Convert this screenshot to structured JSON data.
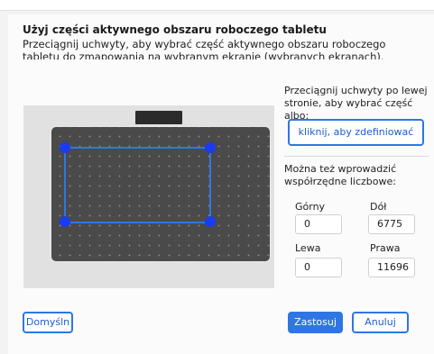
{
  "dialog": {
    "title": "Użyj części aktywnego obszaru roboczego tabletu",
    "description": "Przeciągnij uchwyty, aby wybrać część aktywnego obszaru roboczego tabletu do zmapowania na wybranym ekranie (wybranych ekranach)."
  },
  "side_panel": {
    "drag_instructions": "Przeciągnij uchwyty po lewej stronie, aby wybrać część albo:",
    "define_button": "kliknij, aby zdefiniować",
    "coords_instructions": "Można też wprowadzić współrzędne liczbowe:"
  },
  "coordinates": {
    "top": {
      "label": "Górny",
      "value": "0"
    },
    "bottom": {
      "label": "Dół",
      "value": "6775"
    },
    "left": {
      "label": "Lewa",
      "value": "0"
    },
    "right": {
      "label": "Prawa",
      "value": "11696"
    }
  },
  "buttons": {
    "default": "Domyśln",
    "apply": "Zastosuj",
    "cancel": "Anuluj"
  },
  "colors": {
    "accent": "#2f76e4",
    "handle": "#1a3bf0",
    "tablet": "#4a4a4a"
  }
}
